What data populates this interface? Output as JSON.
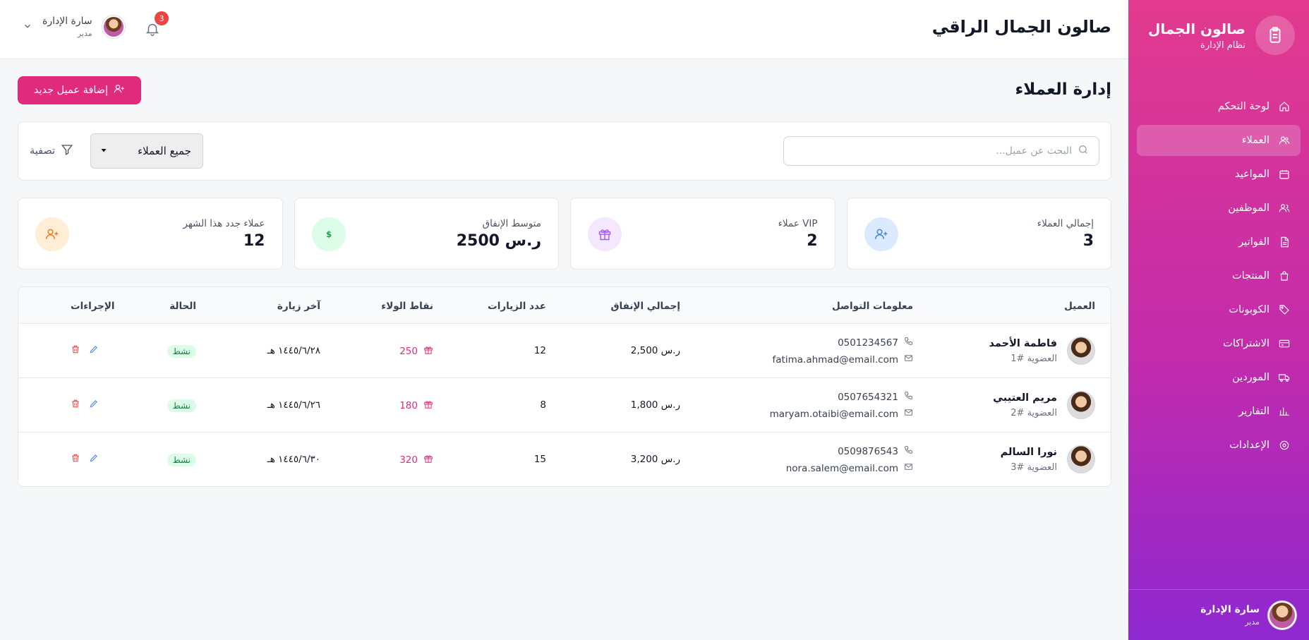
{
  "colors": {
    "accent": "#e02b7c",
    "sidebar_top": "#e23a8e",
    "sidebar_bottom": "#8e28d0",
    "status_bg": "#dcfce7",
    "status_text": "#15803d"
  },
  "sidebar": {
    "brand_title": "صالون الجمال",
    "brand_subtitle": "نظام الإدارة",
    "items": [
      {
        "label": "لوحة التحكم",
        "icon": "home-icon"
      },
      {
        "label": "العملاء",
        "icon": "users-icon",
        "active": true
      },
      {
        "label": "المواعيد",
        "icon": "calendar-icon"
      },
      {
        "label": "الموظفين",
        "icon": "staff-icon"
      },
      {
        "label": "الفواتير",
        "icon": "invoice-icon"
      },
      {
        "label": "المنتجات",
        "icon": "bag-icon"
      },
      {
        "label": "الكوبونات",
        "icon": "tag-icon"
      },
      {
        "label": "الاشتراكات",
        "icon": "card-icon"
      },
      {
        "label": "الموردين",
        "icon": "truck-icon"
      },
      {
        "label": "التقارير",
        "icon": "bar-chart-icon"
      },
      {
        "label": "الإعدادات",
        "icon": "settings-icon"
      }
    ],
    "user": {
      "name": "سارة الإدارة",
      "role": "مدير"
    }
  },
  "header": {
    "title": "صالون الجمال الراقي",
    "notification_count": "3",
    "user": {
      "name": "سارة الإدارة",
      "role": "مدير"
    }
  },
  "main": {
    "page_title": "إدارة العملاء",
    "add_button": "إضافة عميل جديد",
    "search_placeholder": "البحث عن عميل...",
    "filter_select": "جميع العملاء",
    "filter_button": "تصفية"
  },
  "stats": [
    {
      "label": "إجمالي العملاء",
      "value": "3",
      "icon": "user-plus-icon",
      "bg": "#dbeafe",
      "fg": "#3b82f6"
    },
    {
      "label": "عملاء VIP",
      "value": "2",
      "icon": "gift-icon",
      "bg": "#f3e8ff",
      "fg": "#a855f7"
    },
    {
      "label": "متوسط الإنفاق",
      "value": "2500 ر.س",
      "icon": "dollar-icon",
      "bg": "#dcfce7",
      "fg": "#16a34a"
    },
    {
      "label": "عملاء جدد هذا الشهر",
      "value": "12",
      "icon": "user-plus-icon",
      "bg": "#ffedd5",
      "fg": "#f97316"
    }
  ],
  "table": {
    "headers": {
      "client": "العميل",
      "contact": "معلومات التواصل",
      "spend": "إجمالي الإنفاق",
      "visits": "عدد الزيارات",
      "points": "نقاط الولاء",
      "last_visit": "آخر زيارة",
      "status": "الحالة",
      "actions": "الإجراءات"
    },
    "rows": [
      {
        "name": "فاطمة الأحمد",
        "member": "العضوية #1",
        "phone": "0501234567",
        "email": "fatima.ahmad@email.com",
        "spend": "2,500 ر.س",
        "visits": "12",
        "points": "250",
        "last_visit": "١٤٤٥/٦/٢٨ هـ",
        "status": "نشط"
      },
      {
        "name": "مريم العتيبي",
        "member": "العضوية #2",
        "phone": "0507654321",
        "email": "maryam.otaibi@email.com",
        "spend": "1,800 ر.س",
        "visits": "8",
        "points": "180",
        "last_visit": "١٤٤٥/٦/٢٦ هـ",
        "status": "نشط"
      },
      {
        "name": "نورا السالم",
        "member": "العضوية #3",
        "phone": "0509876543",
        "email": "nora.salem@email.com",
        "spend": "3,200 ر.س",
        "visits": "15",
        "points": "320",
        "last_visit": "١٤٤٥/٦/٣٠ هـ",
        "status": "نشط"
      }
    ]
  }
}
